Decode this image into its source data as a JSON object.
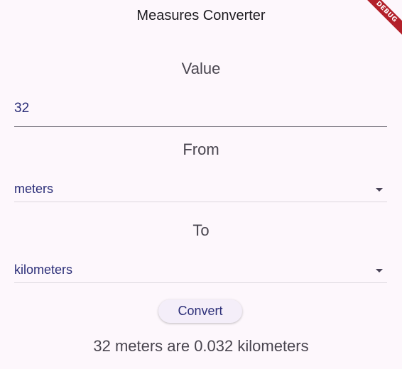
{
  "appbar": {
    "title": "Measures Converter",
    "debug_label": "DEBUG"
  },
  "value_section": {
    "label": "Value",
    "input_value": "32"
  },
  "from_section": {
    "label": "From",
    "selected": "meters"
  },
  "to_section": {
    "label": "To",
    "selected": "kilometers"
  },
  "convert_button": {
    "label": "Convert"
  },
  "result": {
    "text": "32 meters are 0.032 kilometers"
  },
  "colors": {
    "background": "#fdf7fc",
    "accent_text": "#2b2e78",
    "debug_ribbon": "#b3202a"
  }
}
